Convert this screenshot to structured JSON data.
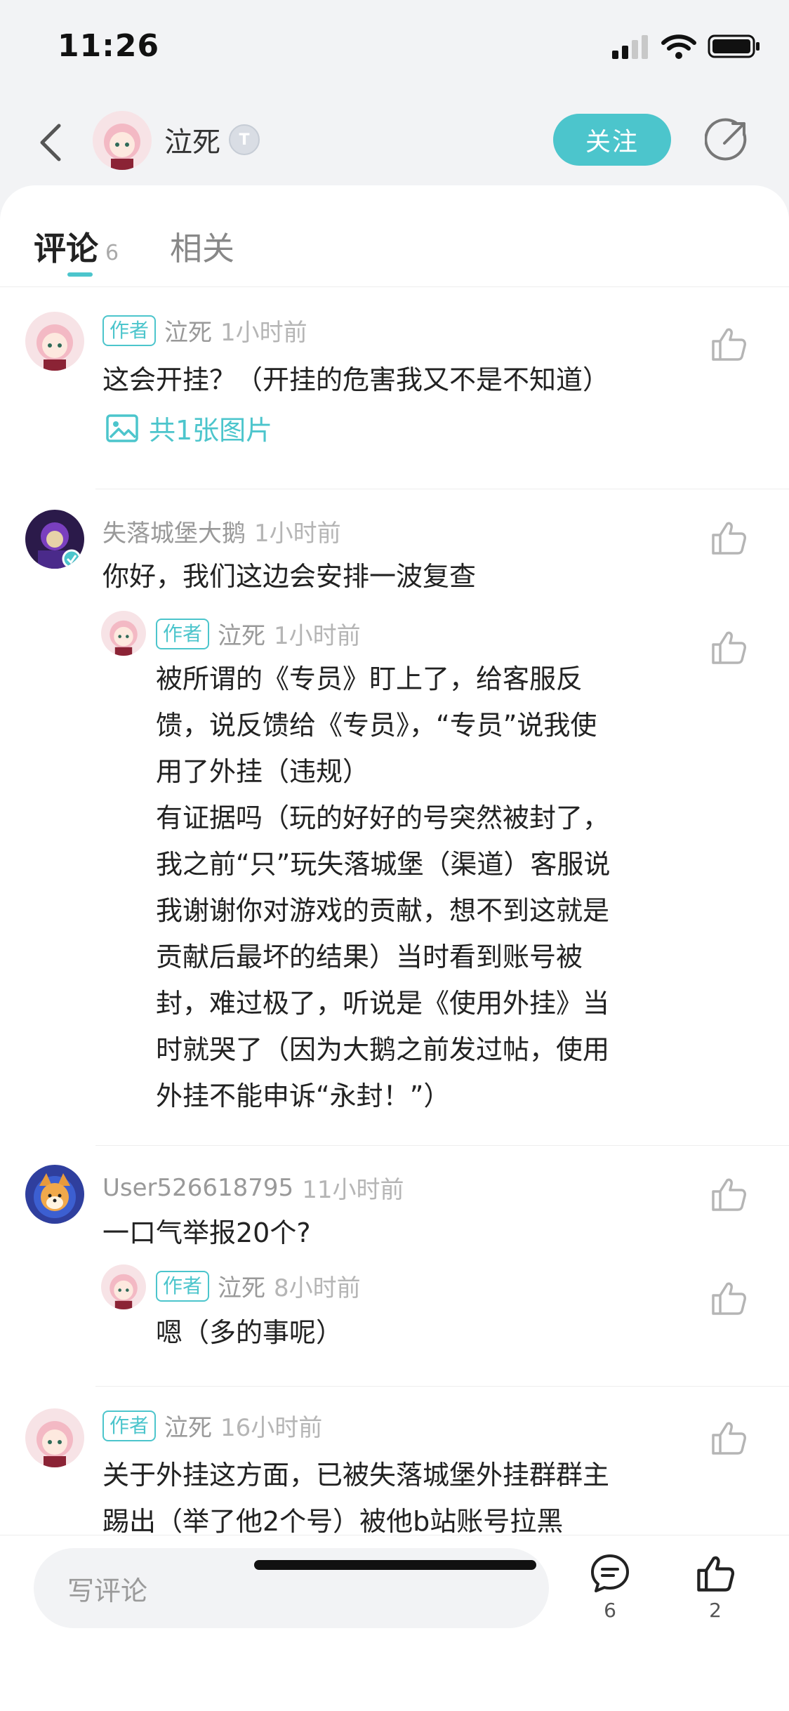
{
  "status_bar": {
    "time": "11:26"
  },
  "header": {
    "user_name": "泣死",
    "follow_label": "关注"
  },
  "tabs": [
    {
      "label": "评论",
      "count": "6"
    },
    {
      "label": "相关"
    }
  ],
  "comments": [
    {
      "is_author": true,
      "author_tag": "作者",
      "name": "泣死",
      "time": "1小时前",
      "text": "这会开挂？（开挂的危害我又不是不知道）",
      "image_link": "共1张图片"
    },
    {
      "is_author": false,
      "name": "失落城堡大鹅",
      "time": "1小时前",
      "text": "你好，我们这边会安排一波复查",
      "reply": {
        "author_tag": "作者",
        "name": "泣死",
        "time": "1小时前",
        "lines": [
          "被所谓的《专员》盯上了，给客服反",
          "馈，说反馈给《专员》，“专员”说我使",
          "用了外挂（违规）",
          "有证据吗（玩的好好的号突然被封了，",
          "我之前“只”玩失落城堡（渠道）客服说",
          "我谢谢你对游戏的贡献，想不到这就是",
          "贡献后最坏的结果）当时看到账号被",
          "封，难过极了，听说是《使用外挂》当",
          "时就哭了（因为大鹅之前发过帖，使用",
          "外挂不能申诉“永封！”）"
        ]
      }
    },
    {
      "is_author": false,
      "name": "User526618795",
      "time": "11小时前",
      "text": "一口气举报20个?",
      "reply": {
        "author_tag": "作者",
        "name": "泣死",
        "time": "8小时前",
        "lines": [
          "嗯（多的事呢）"
        ]
      }
    },
    {
      "is_author": true,
      "author_tag": "作者",
      "name": "泣死",
      "time": "16小时前",
      "lines": [
        "关于外挂这方面，已被失落城堡外挂群群主",
        "踢出（举了他2个号）被他b站账号拉黑"
      ]
    }
  ],
  "bottom_bar": {
    "input_placeholder": "写评论",
    "comment_count": "6",
    "like_count": "2"
  },
  "colors": {
    "accent": "#4cc5cc",
    "background": "#f2f3f5"
  },
  "icons": [
    "back-icon",
    "level-badge-icon",
    "share-icon",
    "image-icon",
    "thumb-up-icon",
    "comment-bubble-icon"
  ]
}
